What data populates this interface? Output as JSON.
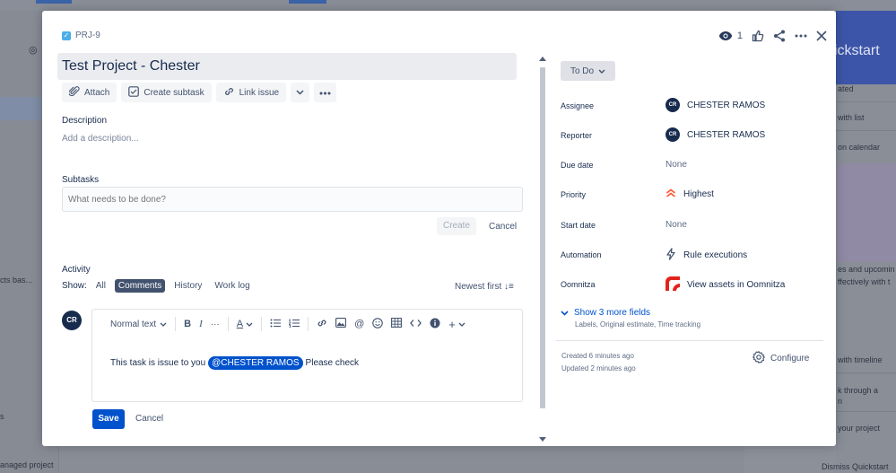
{
  "background": {
    "left_texts": [
      "cts bas...",
      "s",
      "anaged project"
    ],
    "right_panel": {
      "title": "ickstart",
      "items": [
        "ated",
        "with list",
        "on calendar",
        "es and upcomin",
        "ffectively with t",
        "with timeline",
        "k through a",
        "n",
        "your project"
      ],
      "dismiss": "Dismiss Quickstart"
    }
  },
  "issue": {
    "key": "PRJ-9",
    "title": "Test Project - Chester",
    "watch_count": "1"
  },
  "toolbar": {
    "attach": "Attach",
    "create_subtask": "Create subtask",
    "link_issue": "Link issue"
  },
  "description": {
    "label": "Description",
    "placeholder": "Add a description..."
  },
  "subtasks": {
    "label": "Subtasks",
    "placeholder": "What needs to be done?",
    "create": "Create",
    "cancel": "Cancel"
  },
  "activity": {
    "label": "Activity",
    "show_label": "Show:",
    "filters": [
      "All",
      "Comments",
      "History",
      "Work log"
    ],
    "active_filter": "Comments",
    "sort": "Newest first"
  },
  "comment": {
    "avatar_initials": "CR",
    "text_style": "Normal text",
    "text_before": "This task is issue to you",
    "mention": "@CHESTER RAMOS",
    "text_after": "Please check",
    "save": "Save",
    "cancel": "Cancel"
  },
  "status": "To Do",
  "fields": {
    "assignee": {
      "label": "Assignee",
      "value": "CHESTER RAMOS",
      "initials": "CR"
    },
    "reporter": {
      "label": "Reporter",
      "value": "CHESTER RAMOS",
      "initials": "CR"
    },
    "due_date": {
      "label": "Due date",
      "value": "None"
    },
    "priority": {
      "label": "Priority",
      "value": "Highest"
    },
    "start_date": {
      "label": "Start date",
      "value": "None"
    },
    "automation": {
      "label": "Automation",
      "value": "Rule executions"
    },
    "oomnitza": {
      "label": "Oomnitza",
      "value": "View assets in Oomnitza"
    }
  },
  "more_fields": {
    "title": "Show 3 more fields",
    "subtitle": "Labels, Original estimate, Time tracking"
  },
  "meta": {
    "created": "Created 6 minutes ago",
    "updated": "Updated 2 minutes ago",
    "configure": "Configure"
  },
  "colors": {
    "primary": "#0052cc",
    "text": "#172b4d",
    "priority_highest": "#ff5630",
    "oomnitza_red": "#e2231a"
  }
}
